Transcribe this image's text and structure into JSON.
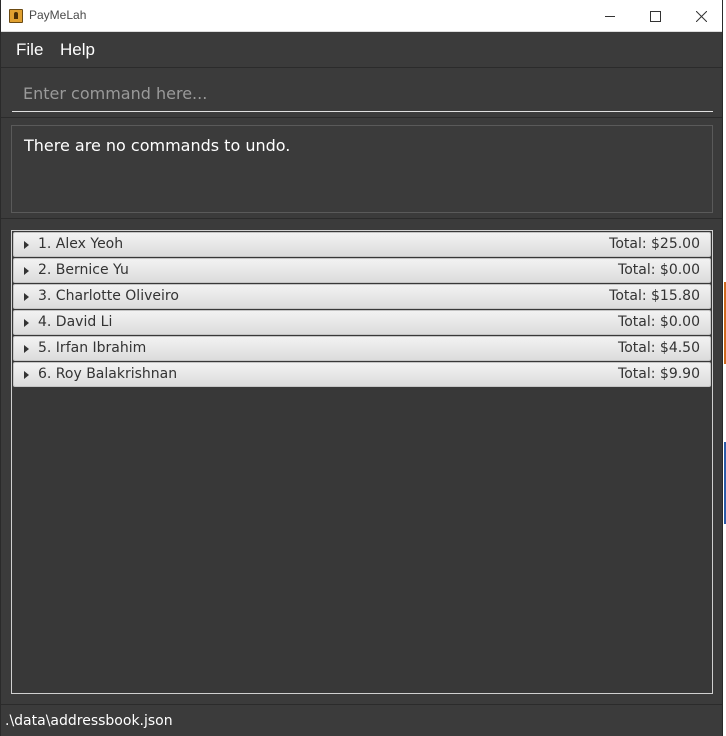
{
  "window": {
    "title": "PayMeLah",
    "icon": "app-icon",
    "controls": [
      "minimize-icon",
      "maximize-icon",
      "close-icon"
    ]
  },
  "menu": {
    "file": "File",
    "help": "Help"
  },
  "command": {
    "placeholder": "Enter command here...",
    "value": ""
  },
  "result": {
    "text": "There are no commands to undo."
  },
  "persons": [
    {
      "name": "1. Alex Yeoh",
      "total": "Total: $25.00"
    },
    {
      "name": "2. Bernice Yu",
      "total": "Total: $0.00"
    },
    {
      "name": "3. Charlotte Oliveiro",
      "total": "Total: $15.80"
    },
    {
      "name": "4. David Li",
      "total": "Total: $0.00"
    },
    {
      "name": "5. Irfan Ibrahim",
      "total": "Total: $4.50"
    },
    {
      "name": "6. Roy Balakrishnan",
      "total": "Total: $9.90"
    }
  ],
  "status": {
    "file_path": ".\\data\\addressbook.json"
  },
  "colors": {
    "background": "#3b3b3b",
    "row_background": "#e6e6e6",
    "text_light": "#ffffff",
    "text_dark": "#333333"
  }
}
